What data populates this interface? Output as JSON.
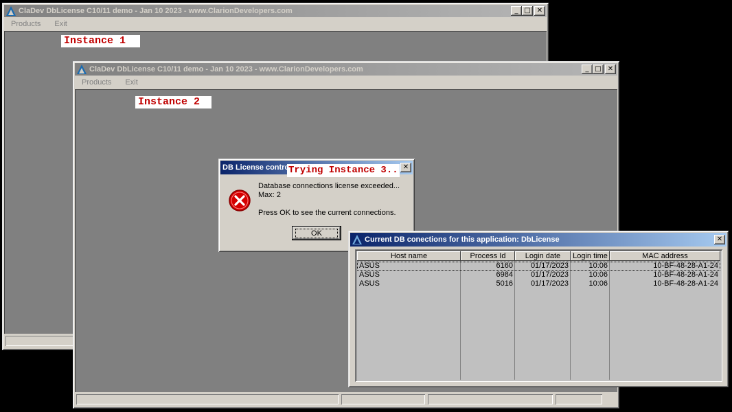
{
  "win1": {
    "title": "ClaDev DbLicense C10/11 demo - Jan 10 2023 - www.ClarionDevelopers.com",
    "menu": [
      "Products",
      "Exit"
    ],
    "instance_label": "Instance 1"
  },
  "win2": {
    "title": "ClaDev DbLicense C10/11 demo - Jan 10 2023 - www.ClarionDevelopers.com",
    "menu": [
      "Products",
      "Exit"
    ],
    "instance_label": "Instance 2"
  },
  "window_buttons": {
    "minimize": "_",
    "maximize": "□",
    "close": "✕"
  },
  "dialog": {
    "title": "DB License control",
    "overlay_label": "Trying Instance 3..",
    "line1": "Database connections license exceeded...",
    "line2": "Max: 2",
    "line3": "Press OK to see the current connections.",
    "ok_label": "OK",
    "icon": "error-icon",
    "icon_glyph": "✕",
    "icon_color": "#d40000"
  },
  "connections": {
    "title": "Current DB conections for this application: DbLicense",
    "columns": [
      "Host name",
      "Process Id",
      "Login date",
      "Login time",
      "MAC address"
    ],
    "rows": [
      [
        "ASUS",
        "6160",
        "01/17/2023",
        "10:06",
        "10-BF-48-28-A1-24"
      ],
      [
        "ASUS",
        "6984",
        "01/17/2023",
        "10:06",
        "10-BF-48-28-A1-24"
      ],
      [
        "ASUS",
        "5016",
        "01/17/2023",
        "10:06",
        "10-BF-48-28-A1-24"
      ]
    ]
  },
  "colors": {
    "active_title": "#0a246a",
    "inactive_title": "#808080",
    "label_red": "#c00000"
  }
}
